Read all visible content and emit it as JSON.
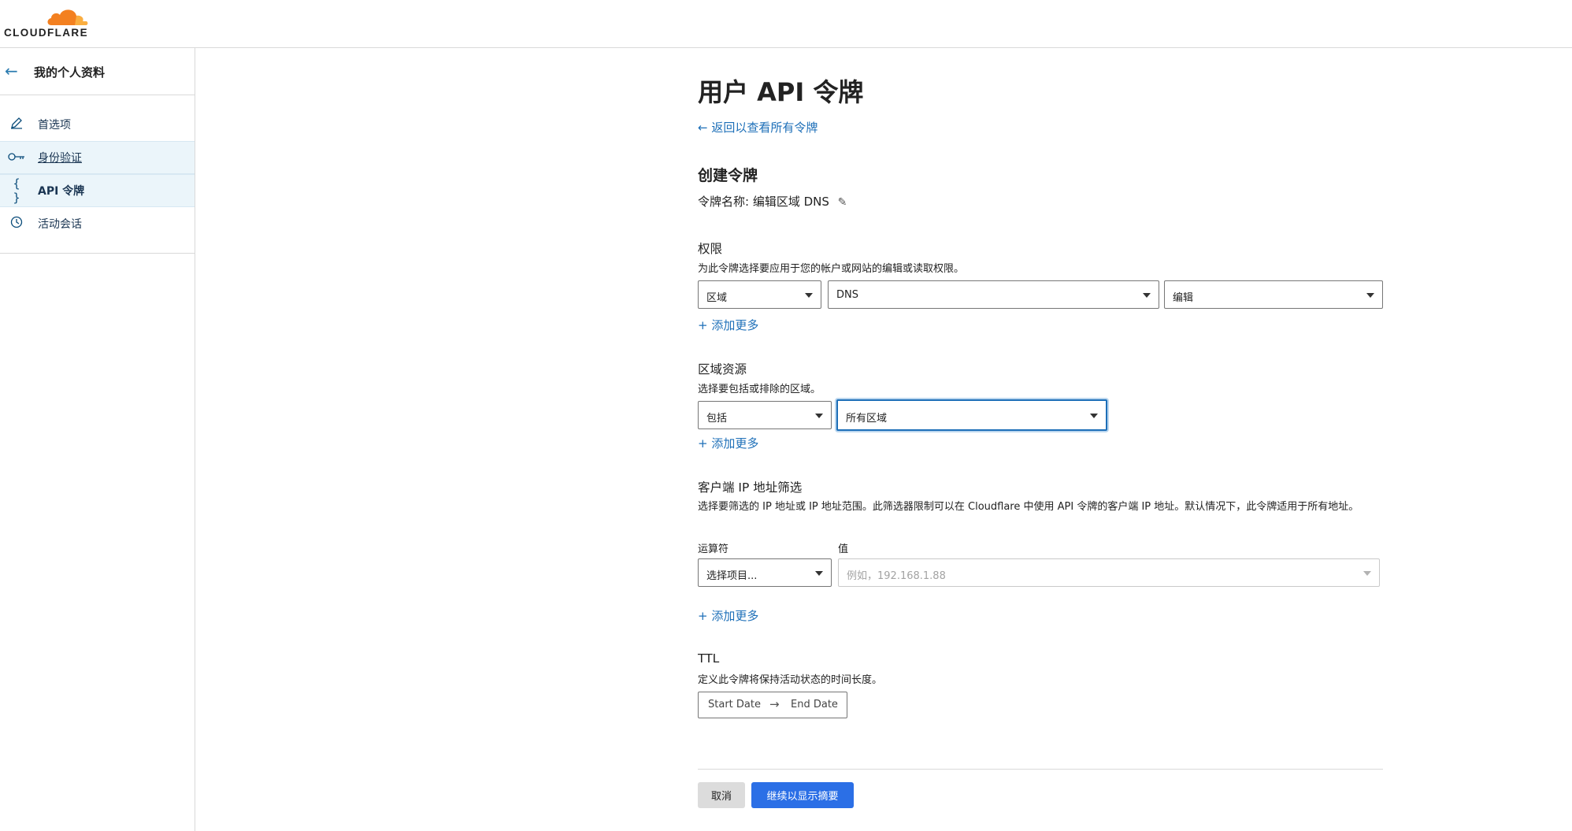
{
  "brand": {
    "name": "CLOUDFLARE",
    "logo_color": "#f38020"
  },
  "sidebar": {
    "title": "我的个人资料",
    "items": [
      {
        "label": "首选项",
        "icon": "pencil-icon"
      },
      {
        "label": "身份验证",
        "icon": "key-icon"
      },
      {
        "label": "API 令牌",
        "icon": "braces-icon",
        "active": true
      },
      {
        "label": "活动会话",
        "icon": "clock-icon"
      }
    ]
  },
  "main": {
    "title": "用户 API 令牌",
    "back_link": "← 返回以查看所有令牌",
    "create_title": "创建令牌",
    "token_name": "令牌名称: 编辑区域 DNS",
    "permissions": {
      "label": "权限",
      "desc": "为此令牌选择要应用于您的帐户或网站的编辑或读取权限。",
      "selects": [
        "区域",
        "DNS",
        "编辑"
      ],
      "add_more": "+ 添加更多"
    },
    "zone_resources": {
      "label": "区域资源",
      "desc": "选择要包括或排除的区域。",
      "selects": [
        "包括",
        "所有区域"
      ],
      "add_more": "+ 添加更多"
    },
    "ip_filter": {
      "label": "客户端 IP 地址筛选",
      "desc": "选择要筛选的 IP 地址或 IP 地址范围。此筛选器限制可以在 Cloudflare 中使用 API 令牌的客户端 IP 地址。默认情况下，此令牌适用于所有地址。",
      "operator_label": "运算符",
      "value_label": "值",
      "operator_value": "选择项目...",
      "value_placeholder": "例如，192.168.1.88",
      "add_more": "+ 添加更多"
    },
    "ttl": {
      "label": "TTL",
      "desc": "定义此令牌将保持活动状态的时间长度。",
      "start": "Start Date",
      "end": "End Date"
    },
    "buttons": {
      "cancel": "取消",
      "continue": "继续以显示摘要"
    }
  },
  "colors": {
    "accent": "#1d6fb8",
    "primary_button": "#2b6fe6",
    "active_bg": "#ebf5fa"
  }
}
